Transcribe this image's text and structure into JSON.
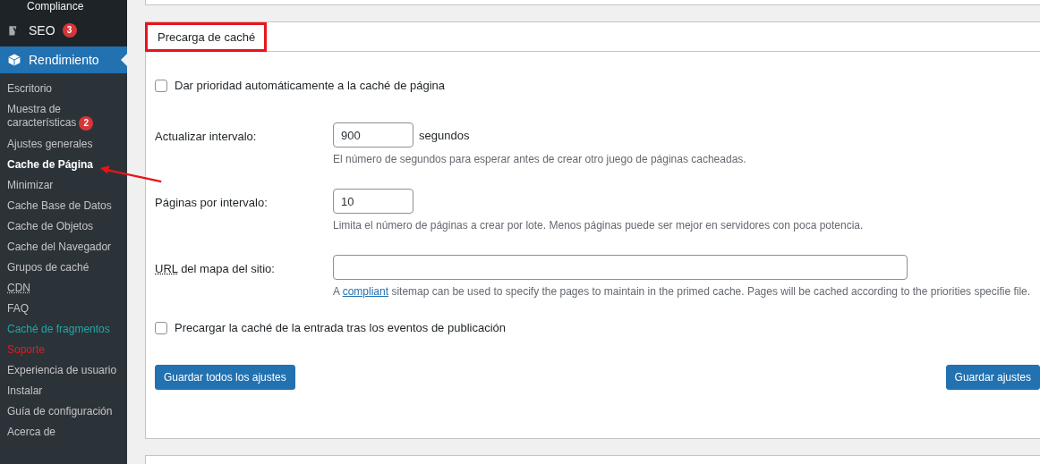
{
  "sidebar": {
    "top_item": "Compliance",
    "menu": [
      {
        "label": "SEO",
        "badge": "3",
        "selected": false,
        "kind": "seo"
      },
      {
        "label": "Rendimiento",
        "selected": true,
        "kind": "performance"
      }
    ],
    "submenu": [
      {
        "label": "Escritorio",
        "current": false
      },
      {
        "label": "Muestra de características",
        "badge": "2",
        "current": false
      },
      {
        "label": "Ajustes generales",
        "current": false
      },
      {
        "label": "Cache de Página",
        "current": true
      },
      {
        "label": "Minimizar",
        "current": false
      },
      {
        "label": "Cache Base de Datos",
        "current": false
      },
      {
        "label": "Cache de Objetos",
        "current": false
      },
      {
        "label": "Cache del Navegador",
        "current": false
      },
      {
        "label": "Grupos de caché",
        "current": false
      },
      {
        "label": "CDN",
        "current": false,
        "abbreviation": true
      },
      {
        "label": "FAQ",
        "current": false
      },
      {
        "label": "Caché de fragmentos",
        "current": false,
        "color": "#1fa8a8"
      },
      {
        "label": "Soporte",
        "current": false,
        "color": "#e11d1d"
      },
      {
        "label": "Experiencia de usuario",
        "current": false
      },
      {
        "label": "Instalar",
        "current": false
      },
      {
        "label": "Guía de configuración",
        "current": false
      },
      {
        "label": "Acerca de",
        "current": false
      }
    ]
  },
  "section": {
    "title": "Precarga de caché",
    "highlighted": true,
    "fields": [
      {
        "kind": "checkbox",
        "label": "Dar prioridad automáticamente a la caché de página",
        "checked": false
      },
      {
        "kind": "input",
        "label": "Actualizar intervalo:",
        "value": "900",
        "unit": "segundos",
        "help": "El número de segundos para esperar antes de crear otro juego de páginas cacheadas."
      },
      {
        "kind": "input",
        "label": "Páginas por intervalo:",
        "value": "10",
        "help": "Limita el número de páginas a crear por lote. Menos páginas puede ser mejor en servidores con poca potencia."
      },
      {
        "kind": "wide-input",
        "abbr": "URL",
        "label": " del mapa del sitio:",
        "help_before": "A ",
        "help_link": "compliant",
        "help_after": " sitemap can be used to specify the pages to maintain in the primed cache. Pages will be cached according to the priorities specifie file."
      },
      {
        "kind": "checkbox",
        "label": "Precargar la caché de la entrada tras los eventos de publicación",
        "checked": false
      }
    ],
    "buttons": [
      "Guardar todos los ajustes",
      "Guardar ajustes"
    ]
  }
}
